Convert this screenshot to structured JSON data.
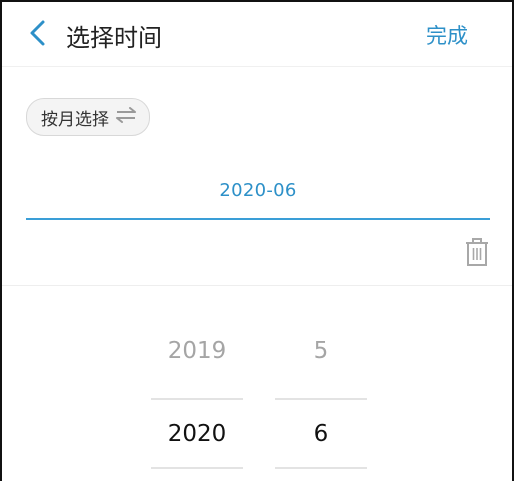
{
  "header": {
    "back_icon": "chevron-left-icon",
    "title": "选择时间",
    "done_label": "完成"
  },
  "mode": {
    "label": "按月选择",
    "icon": "swap-arrows-icon"
  },
  "date_display": {
    "value": "2020-06"
  },
  "trash": {
    "icon": "trash-icon"
  },
  "picker": {
    "year": {
      "prev": "2019",
      "selected": "2020"
    },
    "month": {
      "prev": "5",
      "selected": "6"
    }
  },
  "colors": {
    "accent": "#2d90c8",
    "underline": "#3a9ed7",
    "text": "#222222",
    "muted": "#a5a5a5"
  }
}
